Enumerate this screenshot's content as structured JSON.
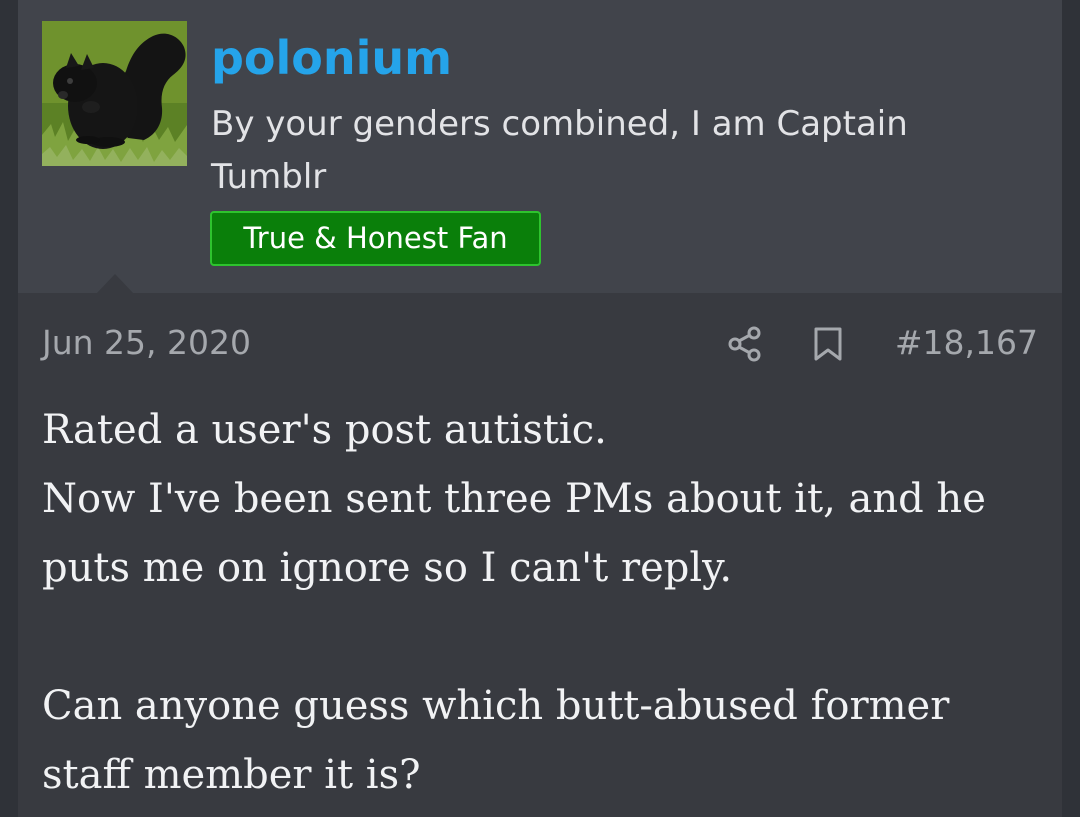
{
  "user": {
    "name": "polonium",
    "title": "By your genders combined, I am Captain Tumblr",
    "banner": "True & Honest Fan",
    "avatar_icon": "black-squirrel-avatar"
  },
  "post": {
    "date": "Jun 25, 2020",
    "number": "#18,167",
    "share_icon": "share-icon",
    "bookmark_icon": "bookmark-icon",
    "body": [
      "Rated a user's post autistic.",
      "Now I've been sent three PMs about it, and he puts me on ignore so I can't reply.",
      "Can anyone guess which butt-abused former staff member it is?"
    ]
  },
  "colors": {
    "page_background": "#2f3238",
    "header_background": "#41444b",
    "post_background": "#383a40",
    "username": "#25a4ea",
    "banner": "#0a7f0a",
    "banner_border": "#2ec32e"
  }
}
